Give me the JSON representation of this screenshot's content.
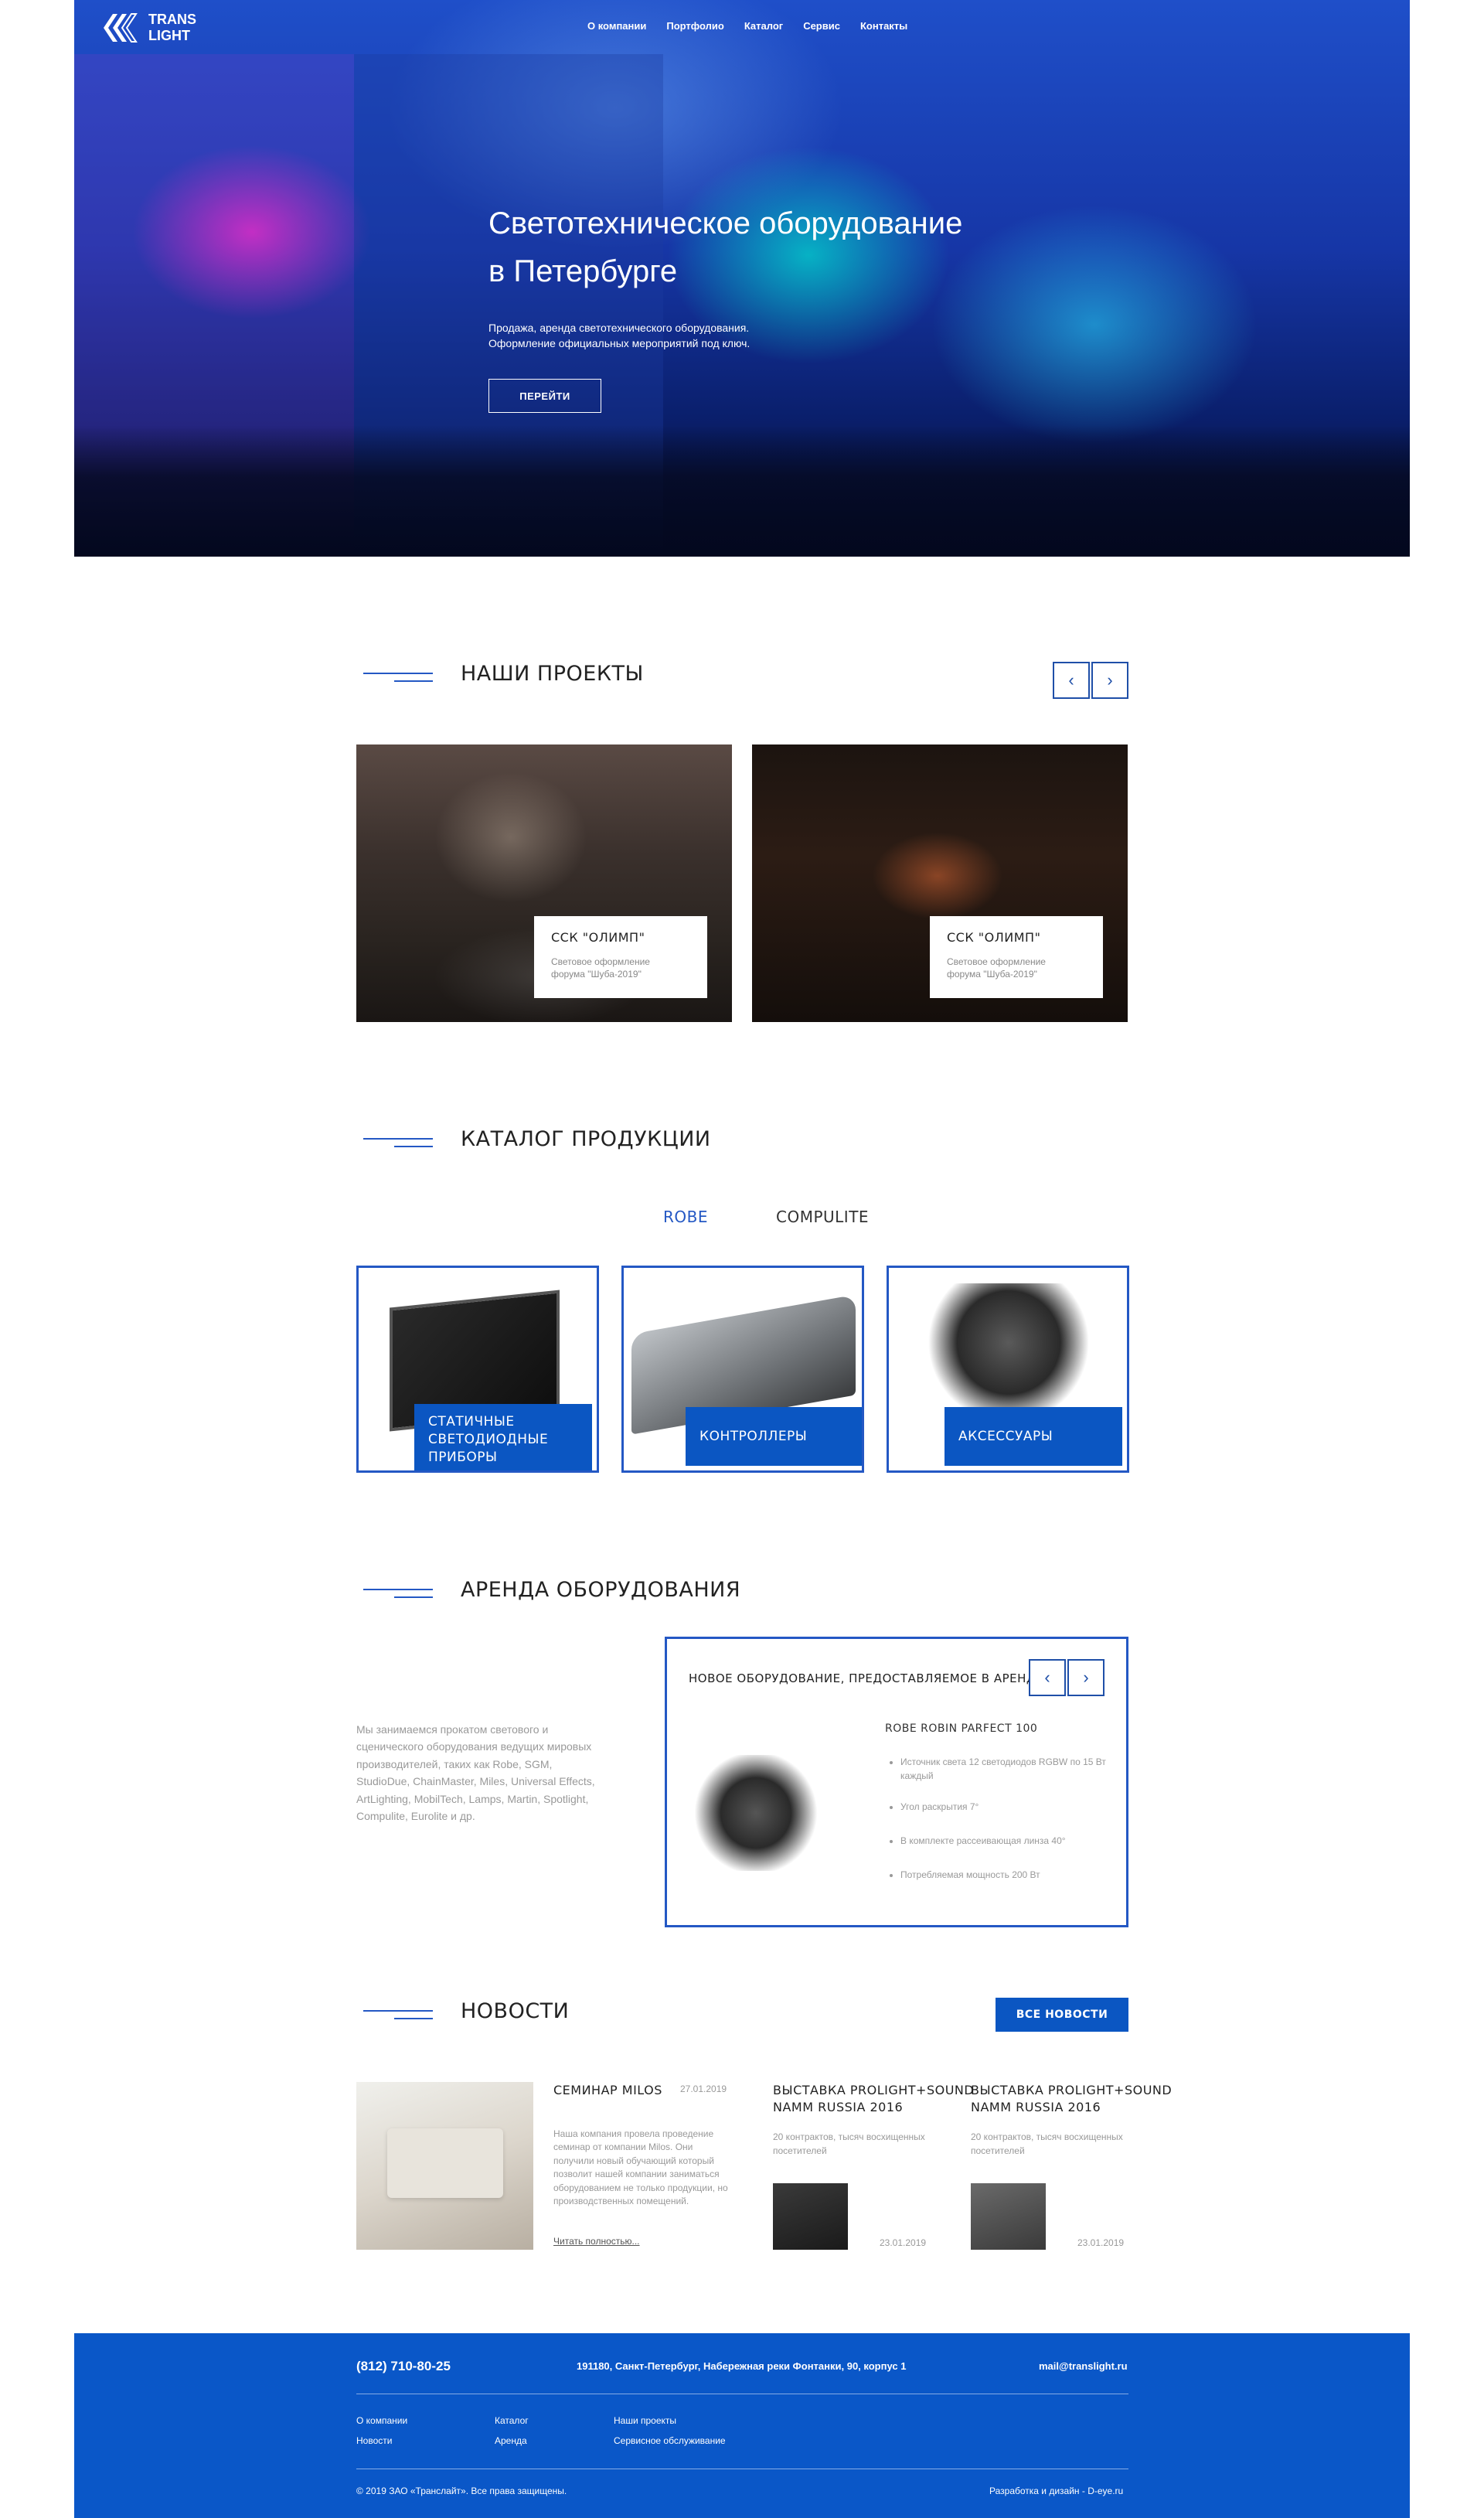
{
  "logo": {
    "line1": "TRANS",
    "line2": "LIGHT"
  },
  "nav": [
    "О компании",
    "Портфолио",
    "Каталог",
    "Сервис",
    "Контакты"
  ],
  "hero": {
    "title_line1": "Светотехническое оборудование",
    "title_line2": "в Петербурге",
    "subtitle_line1": "Продажа, аренда светотехнического оборудования.",
    "subtitle_line2": "Оформление официальных мероприятий под ключ.",
    "button": "ПЕРЕЙТИ"
  },
  "projects": {
    "title": "НАШИ ПРОЕКТЫ",
    "items": [
      {
        "title": "ССК \"ОЛИМП\"",
        "desc_line1": "Световое оформление",
        "desc_line2": "форума \"Шуба-2019\""
      },
      {
        "title": "ССК \"ОЛИМП\"",
        "desc_line1": "Световое оформление",
        "desc_line2": "форума \"Шуба-2019\""
      }
    ]
  },
  "catalog": {
    "title": "КАТАЛОГ ПРОДУКЦИИ",
    "tabs": [
      "ROBE",
      "COMPULITE"
    ],
    "active_tab": "ROBE",
    "items": [
      {
        "label_line1": "СТАТИЧНЫЕ СВЕТОДИОДНЫЕ",
        "label_line2": "ПРИБОРЫ"
      },
      {
        "label_line1": "КОНТРОЛЛЕРЫ",
        "label_line2": ""
      },
      {
        "label_line1": "АКСЕССУАРЫ",
        "label_line2": ""
      }
    ]
  },
  "rental": {
    "title": "АРЕНДА ОБОРУДОВАНИЯ",
    "text": "Мы занимаемся прокатом светового и сценического оборудования ведущих мировых производителей, таких как Robe, SGM, StudioDue, ChainMaster, Miles, Universal Effects, ArtLighting, MobilTech, Lamps, Martin, Spotlight, Compulite, Eurolite и др.",
    "box_title": "НОВОЕ ОБОРУДОВАНИЕ, ПРЕДОСТАВЛЯЕМОЕ В АРЕНДУ:",
    "product_name": "ROBE ROBIN PARFECT 100",
    "specs": [
      "Источник света 12 светодиодов RGBW по 15 Вт каждый",
      "Угол раскрытия 7°",
      "В комплекте рассеивающая линза 40°",
      "Потребляемая мощность 200 Вт"
    ]
  },
  "news": {
    "title": "НОВОСТИ",
    "all_button": "ВСЕ НОВОСТИ",
    "items": [
      {
        "title": "СЕМИНАР MILOS",
        "date": "27.01.2019",
        "text": "Наша компания провела проведение семинар от компании Milos. Они получили новый обучающий который позволит нашей компании заниматься оборудованием не только продукции, но производственных помещений.",
        "more": "Читать полностью..."
      },
      {
        "title_line1": "ВЫСТАВКА PROLIGHT+SOUND",
        "title_line2": "NAMM RUSSIA 2016",
        "text": "20 контрактов, тысяч восхищенных посетителей",
        "date": "23.01.2019"
      },
      {
        "title_line1": "ВЫСТАВКА PROLIGHT+SOUND",
        "title_line2": "NAMM RUSSIA 2016",
        "text": "20 контрактов, тысяч восхищенных посетителей",
        "date": "23.01.2019"
      }
    ]
  },
  "footer": {
    "phone": "(812) 710-80-25",
    "address": "191180, Санкт-Петербург, Набережная реки Фонтанки, 90, корпус 1",
    "email": "mail@translight.ru",
    "links_col1": [
      "О компании",
      "Новости"
    ],
    "links_col2": [
      "Каталог",
      "Аренда"
    ],
    "links_col3": [
      "Наши проекты",
      "Сервисное обслуживание"
    ],
    "copyright": "© 2019 ЗАО «Транслайт». Все права защищены.",
    "credit": "Разработка и дизайн - D-eye.ru"
  },
  "colors": {
    "accent": "#0b56c2",
    "footer_bg": "#0a57c8",
    "hero_bg": "#1a3fb0"
  }
}
